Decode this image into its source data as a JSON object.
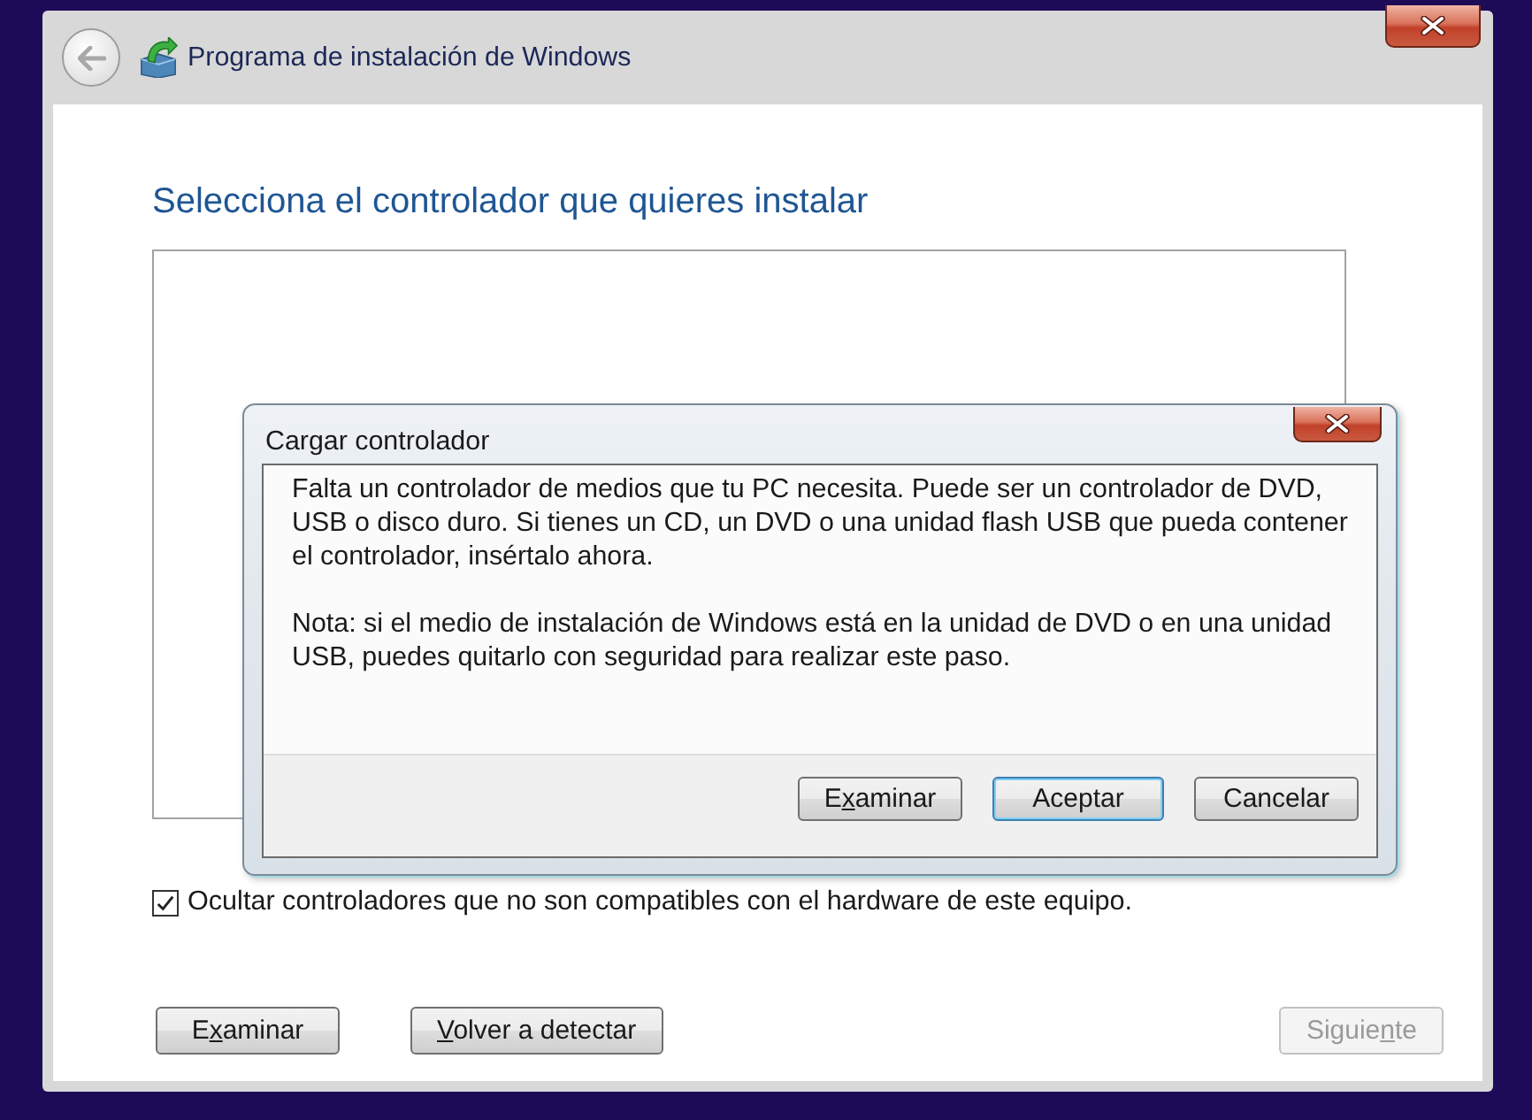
{
  "window": {
    "title": "Programa de instalación de Windows"
  },
  "page": {
    "heading": "Selecciona el controlador que quieres instalar"
  },
  "hide_incompatible": {
    "label": "Ocultar controladores que no son compatibles con el hardware de este equipo.",
    "checked": true
  },
  "buttons": [
    {
      "label_start": "E",
      "access_key": "x",
      "label_end": "aminar",
      "disabled": false
    },
    {
      "access_key": "V",
      "label_end": "olver a detectar",
      "disabled": false
    },
    {
      "label_start": "Siguie",
      "access_key": "n",
      "label_end": "te",
      "disabled": true
    }
  ],
  "dialog": {
    "title": "Cargar controlador",
    "paragraphs": [
      "Falta un controlador de medios que tu PC necesita. Puede ser un controlador de DVD, USB o disco duro. Si tienes un CD, un DVD o una unidad flash USB que pueda contener el controlador, insértalo ahora.",
      "Nota: si el medio de instalación de Windows está en la unidad de DVD o en una unidad USB, puedes quitarlo con seguridad para realizar este paso."
    ],
    "buttons": [
      {
        "label_start": "E",
        "access_key": "x",
        "label_end": "aminar",
        "default": false
      },
      {
        "label": "Aceptar",
        "default": true
      },
      {
        "label": "Cancelar",
        "default": false
      }
    ]
  }
}
